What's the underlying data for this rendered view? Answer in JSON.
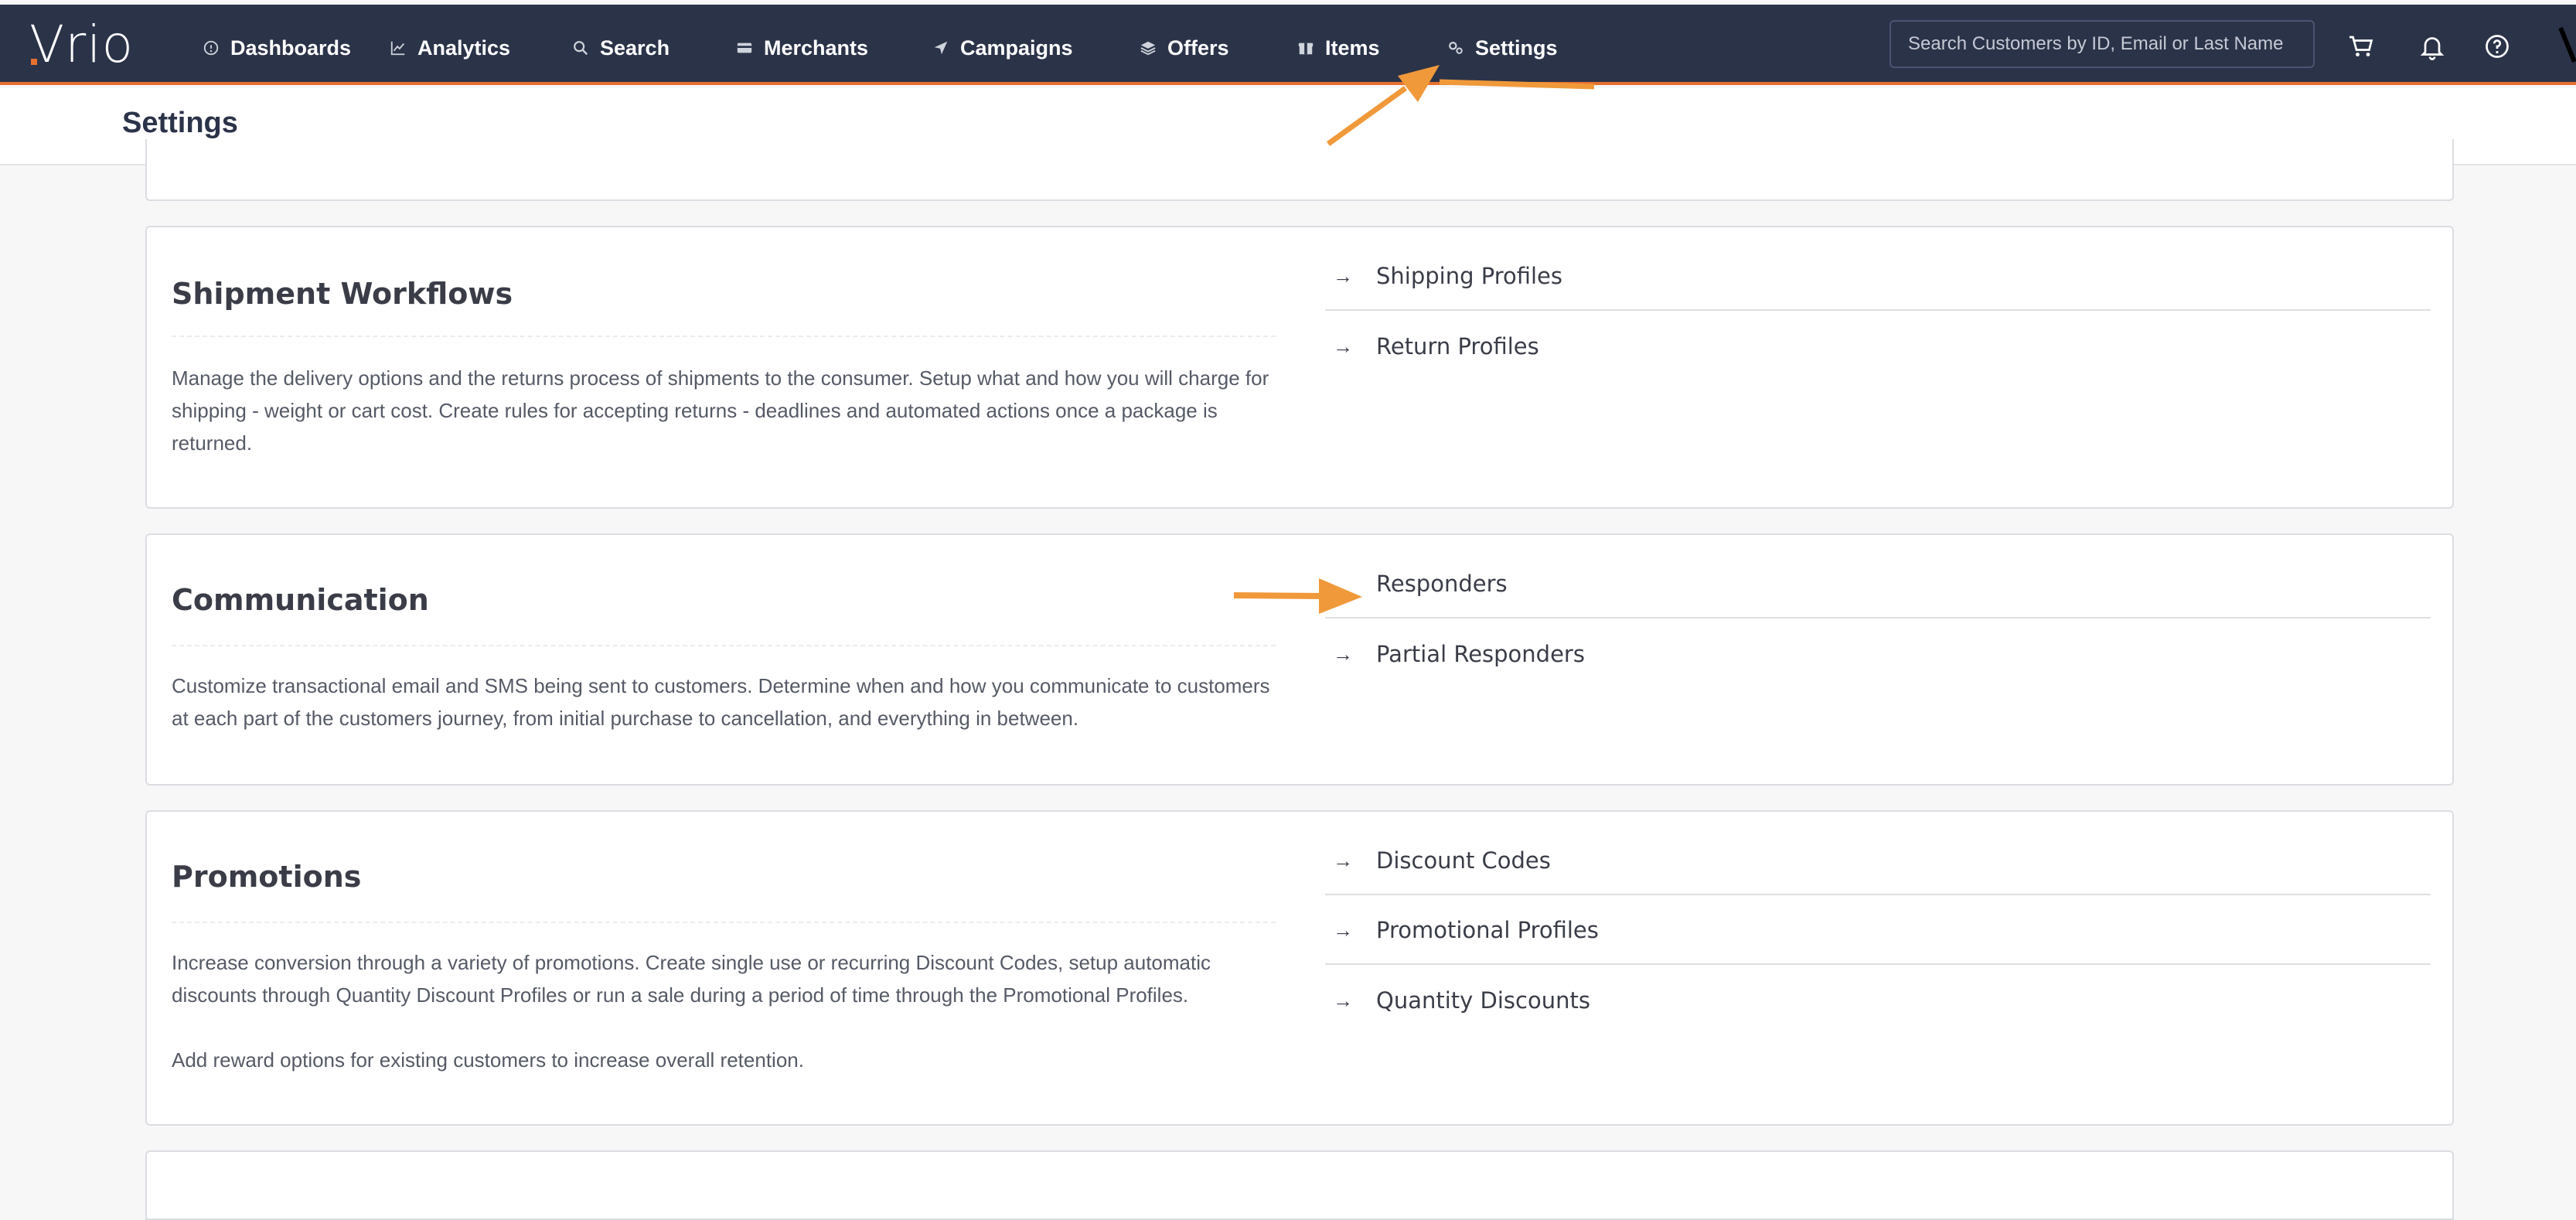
{
  "app": {
    "logo_text": "Vrio"
  },
  "nav": [
    {
      "label": "Dashboards",
      "icon": "info-circle-icon"
    },
    {
      "label": "Analytics",
      "icon": "line-chart-icon"
    },
    {
      "label": "Search",
      "icon": "search-icon"
    },
    {
      "label": "Merchants",
      "icon": "card-icon"
    },
    {
      "label": "Campaigns",
      "icon": "paper-plane-icon"
    },
    {
      "label": "Offers",
      "icon": "layers-icon"
    },
    {
      "label": "Items",
      "icon": "box-icon"
    },
    {
      "label": "Settings",
      "icon": "gears-icon"
    }
  ],
  "search": {
    "placeholder": "Search Customers by ID, Email or Last Name"
  },
  "header_icons": [
    "cart-icon",
    "bell-icon",
    "help-circle-icon"
  ],
  "page": {
    "title": "Settings"
  },
  "sections": [
    {
      "title": "Shipment Workflows",
      "description": "Manage the delivery options and the returns process of shipments to the consumer. Setup what and how you will charge for shipping - weight or cart cost. Create rules for accepting returns - deadlines and automated actions once a package is returned.",
      "links": [
        "Shipping Profiles",
        "Return Profiles"
      ]
    },
    {
      "title": "Communication",
      "description": "Customize transactional email and SMS being sent to customers. Determine when and how you communicate to customers at each part of the customers journey, from initial purchase to cancellation, and everything in between.",
      "links": [
        "Responders",
        "Partial Responders"
      ]
    },
    {
      "title": "Promotions",
      "description": "Increase conversion through a variety of promotions. Create single use or recurring Discount Codes, setup automatic discounts through Quantity Discount Profiles or run a sale during a period of time through the Promotional Profiles.",
      "description_2": "Add reward options for existing customers to increase overall retention.",
      "links": [
        "Discount Codes",
        "Promotional Profiles",
        "Quantity Discounts"
      ]
    }
  ],
  "link_arrow_glyph": "→",
  "colors": {
    "topbar": "#2b3349",
    "accent": "#e8702f",
    "annotation": "#f0993a"
  }
}
